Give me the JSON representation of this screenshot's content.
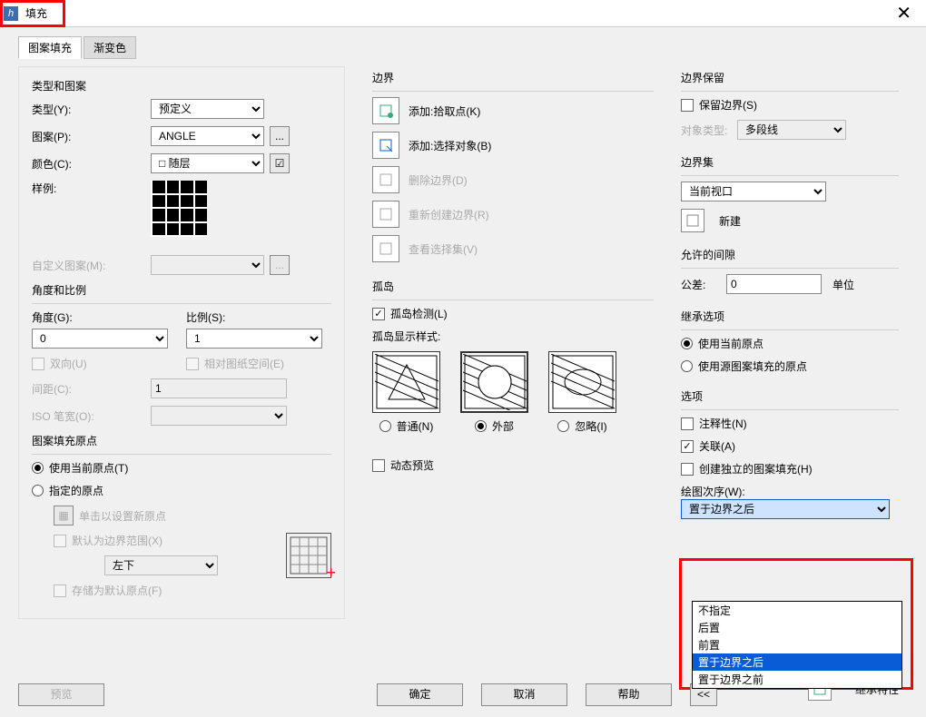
{
  "title": "填充",
  "close": "✕",
  "tabs": {
    "fill": "图案填充",
    "grad": "渐变色"
  },
  "typePattern": {
    "legend": "类型和图案",
    "type_lbl": "类型(Y):",
    "type_val": "预定义",
    "pat_lbl": "图案(P):",
    "pat_val": "ANGLE",
    "color_lbl": "颜色(C):",
    "color_val": "□ 随层",
    "sample_lbl": "样例:",
    "custom_lbl": "自定义图案(M):",
    "ellipsis": "..."
  },
  "angleScale": {
    "legend": "角度和比例",
    "angle_lbl": "角度(G):",
    "angle_val": "0",
    "scale_lbl": "比例(S):",
    "scale_val": "1",
    "double_lbl": "双向(U)",
    "relpaper_lbl": "相对图纸空间(E)",
    "spacing_lbl": "间距(C):",
    "spacing_val": "1",
    "iso_lbl": "ISO 笔宽(O):"
  },
  "origin": {
    "legend": "图案填充原点",
    "use_current": "使用当前原点(T)",
    "specify": "指定的原点",
    "click_new": "单击以设置新原点",
    "default_bound": "默认为边界范围(X)",
    "pos_val": "左下",
    "store_default": "存储为默认原点(F)"
  },
  "boundary": {
    "legend": "边界",
    "add_pick": "添加:拾取点(K)",
    "add_select": "添加:选择对象(B)",
    "delete": "删除边界(D)",
    "recreate": "重新创建边界(R)",
    "view": "查看选择集(V)"
  },
  "island": {
    "legend": "孤岛",
    "detect": "孤岛检测(L)",
    "style": "孤岛显示样式:",
    "normal": "普通(N)",
    "outer": "外部",
    "ignore": "忽略(I)"
  },
  "dyn_preview": "动态预览",
  "keep_boundary": {
    "legend": "边界保留",
    "keep_lbl": "保留边界(S)",
    "objtype_lbl": "对象类型:",
    "objtype_val": "多段线"
  },
  "bound_set": {
    "legend": "边界集",
    "val": "当前视口",
    "new": "新建"
  },
  "gap": {
    "legend": "允许的间隙",
    "tol": "公差:",
    "val": "0",
    "unit": "单位"
  },
  "inherit_opt": {
    "legend": "继承选项",
    "current": "使用当前原点",
    "source": "使用源图案填充的原点"
  },
  "options": {
    "legend": "选项",
    "annotative": "注释性(N)",
    "assoc": "关联(A)",
    "separate": "创建独立的图案填充(H)"
  },
  "draw_order": {
    "lbl": "绘图次序(W):",
    "val": "置于边界之后",
    "opts": [
      "不指定",
      "后置",
      "前置",
      "置于边界之后",
      "置于边界之前"
    ]
  },
  "inherit_props": "继承特性",
  "footer": {
    "preview": "预览",
    "ok": "确定",
    "cancel": "取消",
    "help": "帮助",
    "expand": "<<"
  }
}
